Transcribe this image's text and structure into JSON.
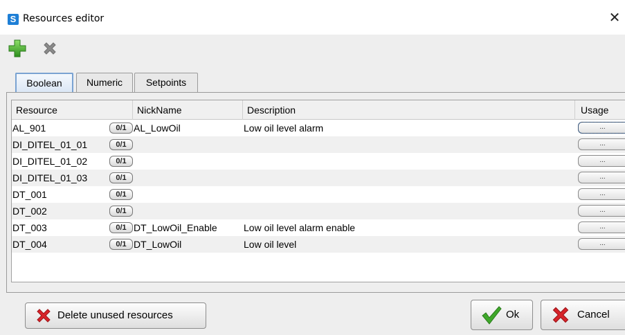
{
  "window": {
    "title": "Resources editor",
    "close_glyph": "✕"
  },
  "toolbar": {
    "add_icon": "plus-icon",
    "remove_icon": "x-icon"
  },
  "tabs": [
    {
      "label": "Boolean",
      "active": true
    },
    {
      "label": "Numeric",
      "active": false
    },
    {
      "label": "Setpoints",
      "active": false
    }
  ],
  "table": {
    "columns": [
      "Resource",
      "NickName",
      "Description",
      "Usage"
    ],
    "rows": [
      {
        "resource": "AL_901",
        "badge": "0/1",
        "nickname": "AL_LowOil",
        "description": "Low oil level alarm",
        "usage": "..."
      },
      {
        "resource": "DI_DITEL_01_01",
        "badge": "0/1",
        "nickname": "",
        "description": "",
        "usage": "..."
      },
      {
        "resource": "DI_DITEL_01_02",
        "badge": "0/1",
        "nickname": "",
        "description": "",
        "usage": "..."
      },
      {
        "resource": "DI_DITEL_01_03",
        "badge": "0/1",
        "nickname": "",
        "description": "",
        "usage": "..."
      },
      {
        "resource": "DT_001",
        "badge": "0/1",
        "nickname": "",
        "description": "",
        "usage": "..."
      },
      {
        "resource": "DT_002",
        "badge": "0/1",
        "nickname": "",
        "description": "",
        "usage": "..."
      },
      {
        "resource": "DT_003",
        "badge": "0/1",
        "nickname": "DT_LowOil_Enable",
        "description": "Low oil level alarm enable",
        "usage": "..."
      },
      {
        "resource": "DT_004",
        "badge": "0/1",
        "nickname": "DT_LowOil",
        "description": "Low oil level",
        "usage": "..."
      }
    ]
  },
  "buttons": {
    "delete_unused": "Delete unused resources",
    "ok": "Ok",
    "cancel": "Cancel"
  },
  "colors": {
    "accent_green": "#3fa82a",
    "accent_red": "#d8242a",
    "tab_active_border": "#7aa3d2"
  }
}
